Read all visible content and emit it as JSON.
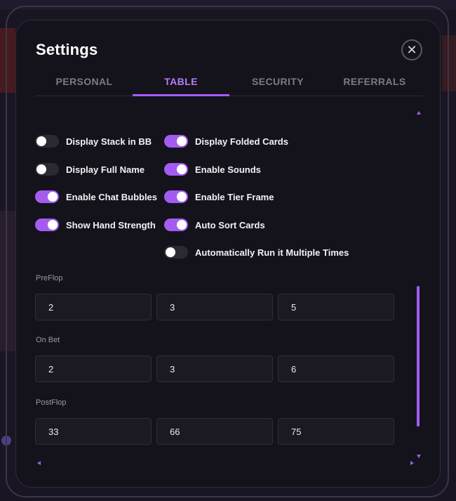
{
  "dialog": {
    "title": "Settings",
    "close_glyph": "✕"
  },
  "tabs": [
    {
      "label": "PERSONAL",
      "active": false
    },
    {
      "label": "TABLE",
      "active": true
    },
    {
      "label": "SECURITY",
      "active": false
    },
    {
      "label": "REFERRALS",
      "active": false
    }
  ],
  "toggles": {
    "display_stack_in_bb": {
      "label": "Display Stack in BB",
      "on": false
    },
    "display_full_name": {
      "label": "Display Full Name",
      "on": false
    },
    "enable_chat_bubbles": {
      "label": "Enable Chat Bubbles",
      "on": true
    },
    "show_hand_strength": {
      "label": "Show Hand Strength",
      "on": true
    },
    "display_folded_cards": {
      "label": "Display Folded Cards",
      "on": true
    },
    "enable_sounds": {
      "label": "Enable Sounds",
      "on": true
    },
    "enable_tier_frame": {
      "label": "Enable Tier Frame",
      "on": true
    },
    "auto_sort_cards": {
      "label": "Auto Sort Cards",
      "on": true
    },
    "auto_run_it_multiple": {
      "label": "Automatically Run it Multiple Times",
      "on": false
    }
  },
  "bet_presets": {
    "preflop": {
      "label": "PreFlop",
      "values": [
        "2",
        "3",
        "5"
      ]
    },
    "on_bet": {
      "label": "On Bet",
      "values": [
        "2",
        "3",
        "6"
      ]
    },
    "postflop": {
      "label": "PostFlop",
      "values": [
        "33",
        "66",
        "75"
      ]
    }
  },
  "colors": {
    "accent": "#a45cff",
    "modal_bg": "#14131b",
    "toggle_off": "#2b2a33"
  }
}
